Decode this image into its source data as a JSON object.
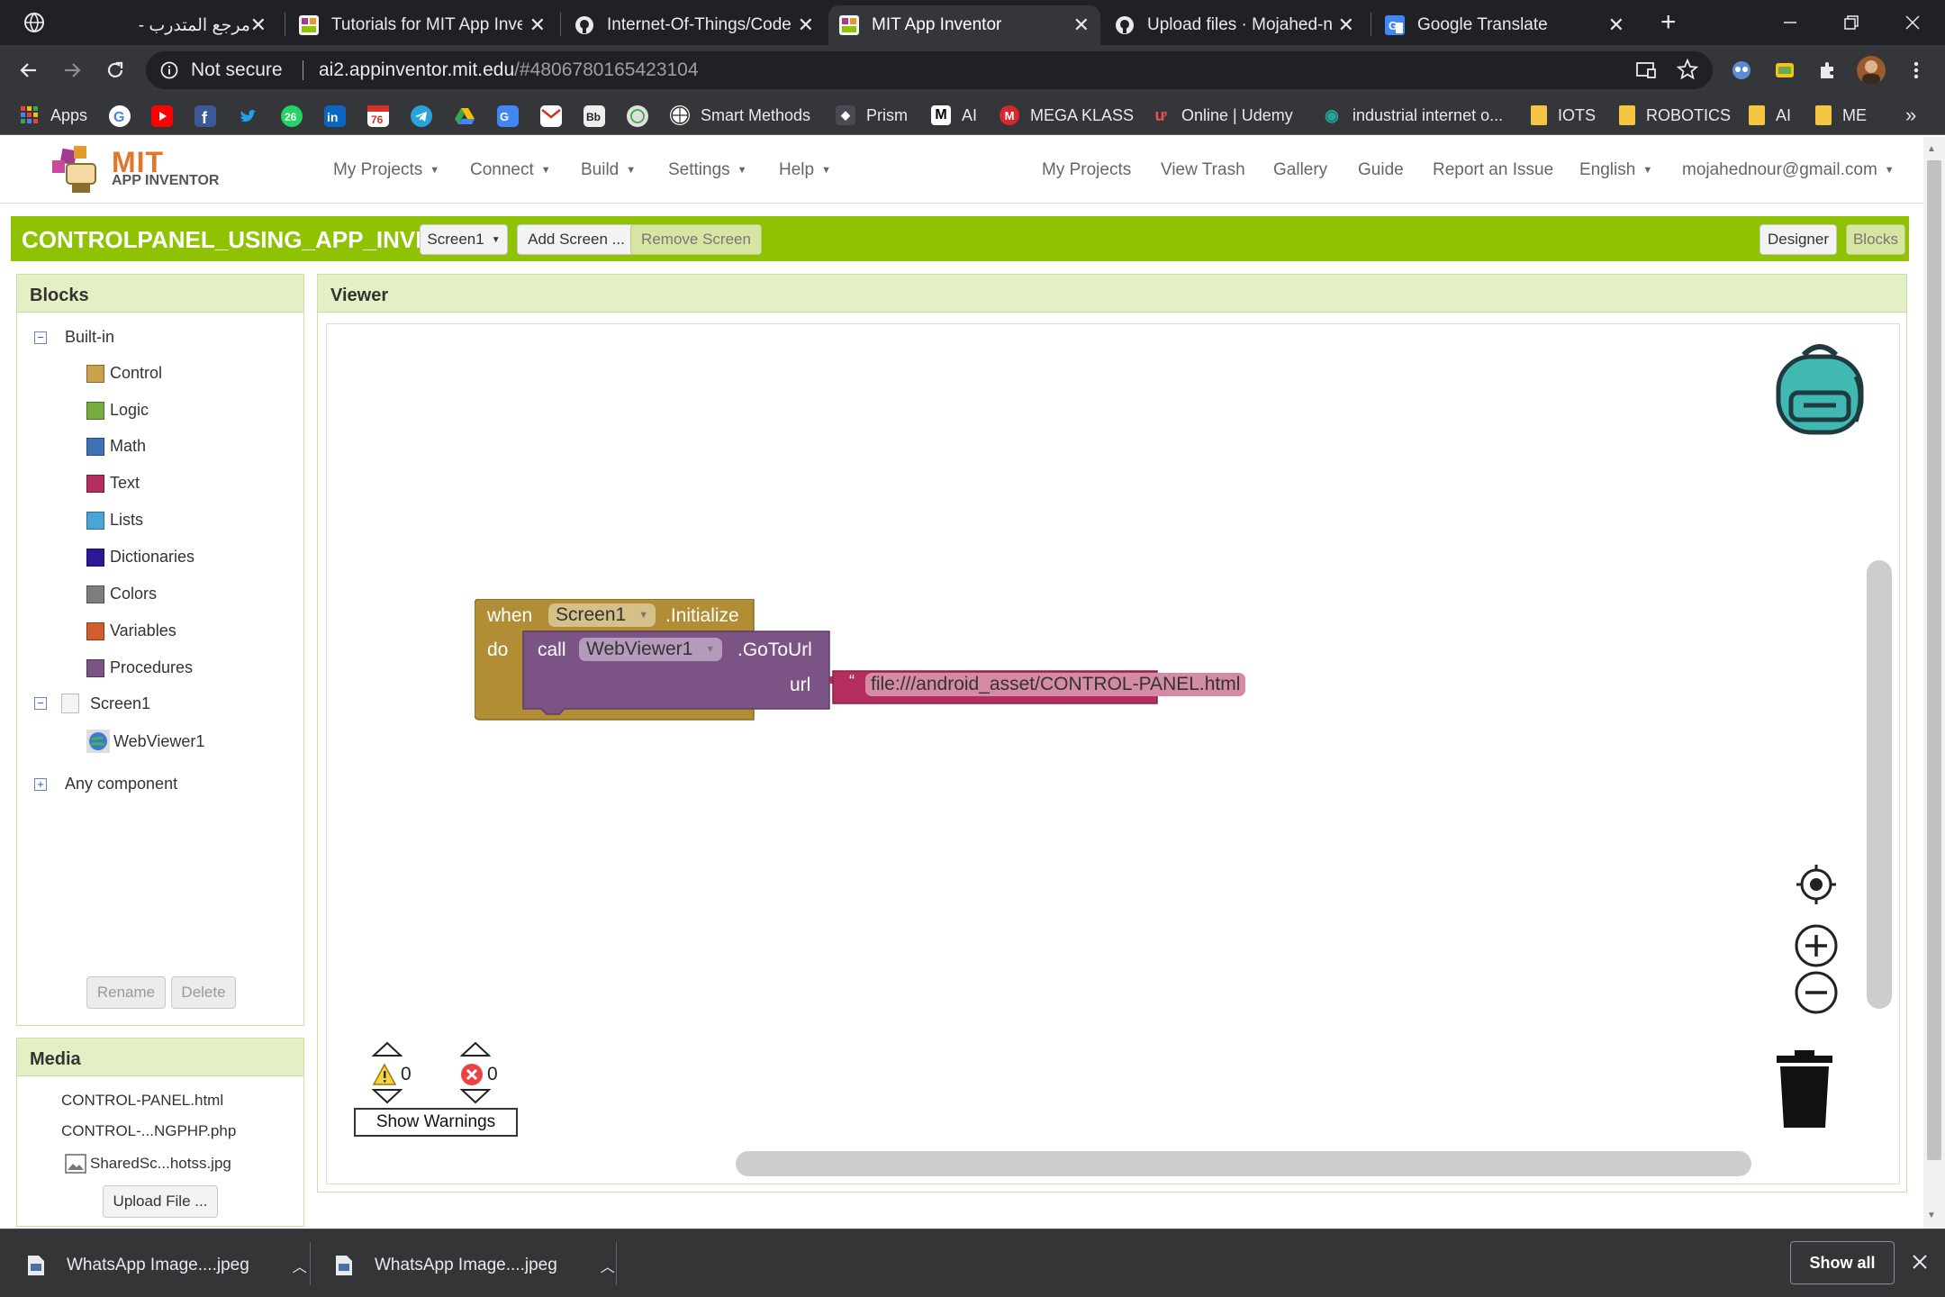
{
  "browser": {
    "tabs": [
      {
        "title": "مرجع المتدرب -",
        "favicon": "globe-icon",
        "active": false
      },
      {
        "title": "Tutorials for MIT App Inve",
        "favicon": "appinventor-icon",
        "active": false
      },
      {
        "title": "Internet-Of-Things/Code",
        "favicon": "github-icon",
        "active": false
      },
      {
        "title": "MIT App Inventor",
        "favicon": "appinventor-icon",
        "active": true
      },
      {
        "title": "Upload files · Mojahed-no",
        "favicon": "github-icon",
        "active": false
      },
      {
        "title": "Google Translate",
        "favicon": "translate-icon",
        "active": false
      }
    ],
    "security_label": "Not secure",
    "url_host": "ai2.appinventor.mit.edu",
    "url_path": "/#4806780165423104",
    "bookmarks": {
      "apps": "Apps",
      "smart_methods": "Smart Methods",
      "prism": "Prism",
      "ai_m": "AI",
      "mega_klass": "MEGA KLASS",
      "udemy": "Online | Udemy",
      "industrial": "industrial internet o...",
      "iots": "IOTS",
      "robotics": "ROBOTICS",
      "ai_folder": "AI",
      "me": "ME",
      "more": "»"
    }
  },
  "app": {
    "logo_line1": "MIT",
    "logo_line2": "APP INVENTOR",
    "menu": {
      "my_projects": "My Projects",
      "connect": "Connect",
      "build": "Build",
      "settings": "Settings",
      "help": "Help"
    },
    "right_links": {
      "my_projects": "My Projects",
      "view_trash": "View Trash",
      "gallery": "Gallery",
      "guide": "Guide",
      "report_issue": "Report an Issue",
      "language": "English",
      "account": "mojahednour@gmail.com"
    },
    "project_title": "CONTROLPANEL_USING_APP_INVE",
    "screen_select": "Screen1",
    "add_screen": "Add Screen ...",
    "remove_screen": "Remove Screen",
    "designer": "Designer",
    "blocks": "Blocks"
  },
  "blocks_panel": {
    "heading": "Blocks",
    "builtin": "Built-in",
    "categories": [
      {
        "label": "Control",
        "color": "#C8A14A"
      },
      {
        "label": "Logic",
        "color": "#77AB41"
      },
      {
        "label": "Math",
        "color": "#3F71B5"
      },
      {
        "label": "Text",
        "color": "#B32D5E"
      },
      {
        "label": "Lists",
        "color": "#49A6D4"
      },
      {
        "label": "Dictionaries",
        "color": "#2D1799"
      },
      {
        "label": "Colors",
        "color": "#7D7D7D"
      },
      {
        "label": "Variables",
        "color": "#D05F2D"
      },
      {
        "label": "Procedures",
        "color": "#7C5385"
      }
    ],
    "screen": "Screen1",
    "component": "WebViewer1",
    "any_component": "Any component",
    "rename": "Rename",
    "delete": "Delete"
  },
  "media_panel": {
    "heading": "Media",
    "files": [
      "CONTROL-PANEL.html",
      "CONTROL-...NGPHP.php",
      "SharedSc...hotss.jpg"
    ],
    "upload": "Upload File ..."
  },
  "viewer": {
    "heading": "Viewer",
    "event_block": {
      "when": "when",
      "component": "Screen1",
      "event": ".Initialize",
      "do": "do"
    },
    "call_block": {
      "call": "call",
      "component": "WebViewer1",
      "method": ".GoToUrl",
      "param": "url"
    },
    "text_block": {
      "open_quote": "“",
      "value": "file:///android_asset/CONTROL-PANEL.html",
      "close_quote": "”"
    },
    "warnings_count": "0",
    "errors_count": "0",
    "show_warnings": "Show Warnings"
  },
  "downloads": {
    "items": [
      "WhatsApp Image....jpeg",
      "WhatsApp Image....jpeg"
    ],
    "show_all": "Show all"
  },
  "colors": {
    "accent_green": "#8FC202",
    "panel_header": "#E2F0C4",
    "event_block": "#B18E35",
    "call_block": "#7C5385",
    "text_block": "#B32D5E"
  }
}
